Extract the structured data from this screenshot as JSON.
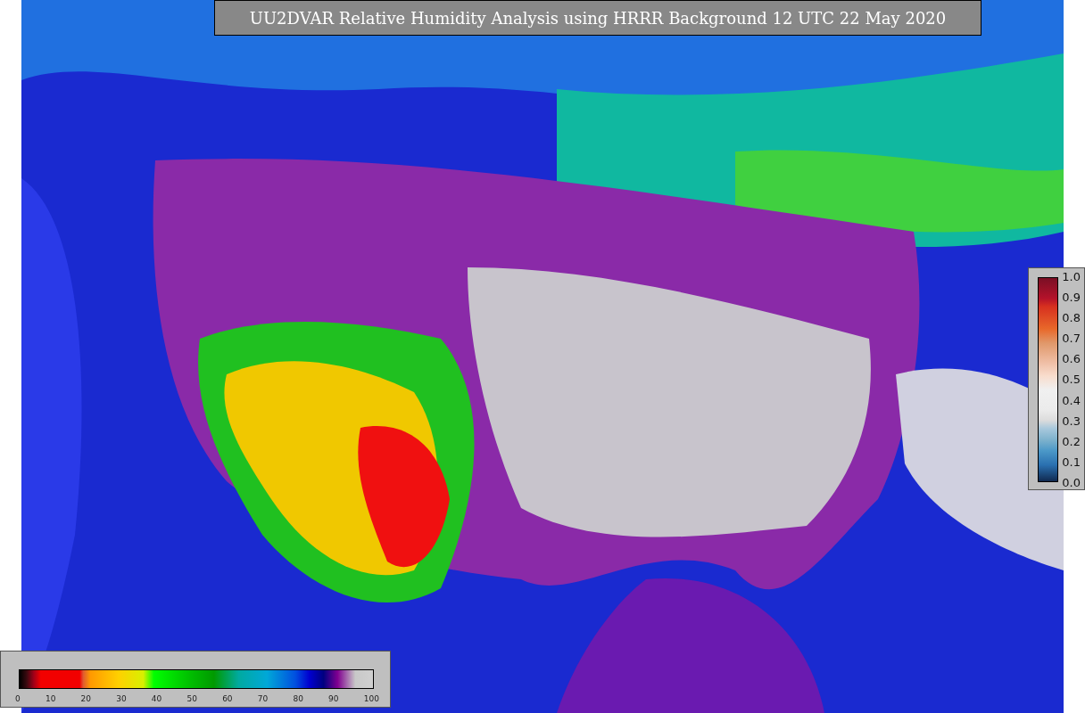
{
  "title": "UU2DVAR Relative Humidity Analysis using HRRR Background 12 UTC 22 May 2020",
  "humidity_colorbar": {
    "ticks": [
      "0",
      "10",
      "20",
      "30",
      "40",
      "50",
      "60",
      "70",
      "80",
      "90",
      "100"
    ]
  },
  "weight_colorbar": {
    "ticks": [
      "1.0",
      "0.9",
      "0.8",
      "0.7",
      "0.6",
      "0.5",
      "0.4",
      "0.3",
      "0.2",
      "0.1",
      "0.0"
    ]
  }
}
